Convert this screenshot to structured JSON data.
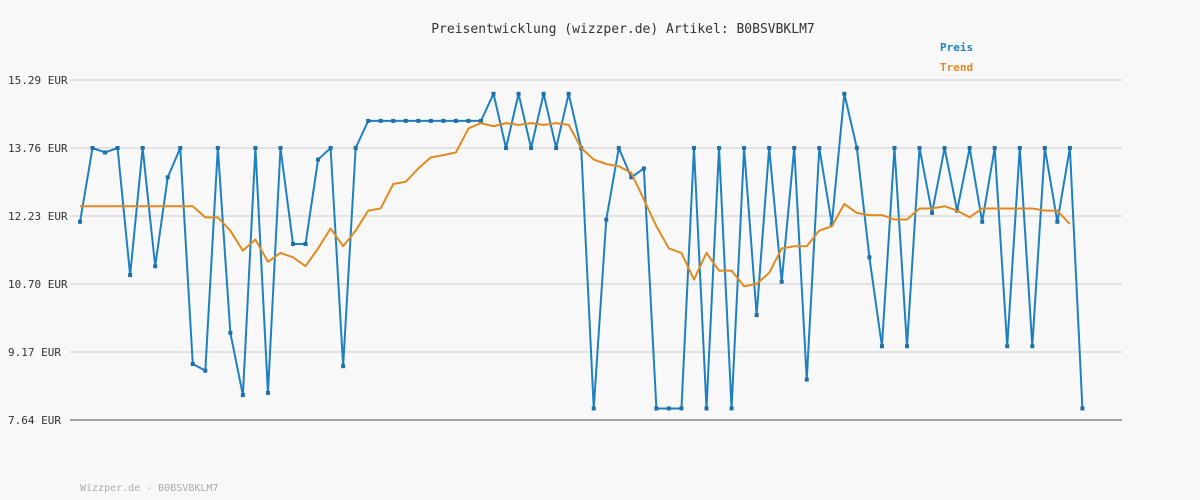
{
  "chart_data": {
    "type": "line",
    "title": "Preisentwicklung (wizzper.de) Artikel: B0BSVBKLM7",
    "xlabel": "",
    "ylabel": "",
    "ylim": [
      7.64,
      15.29
    ],
    "yticks": [
      "15.29 EUR",
      "13.76 EUR",
      "12.23 EUR",
      "10.70 EUR",
      "9.17 EUR",
      "7.64 EUR"
    ],
    "ytick_values": [
      15.29,
      13.76,
      12.23,
      10.7,
      9.17,
      7.64
    ],
    "grid": true,
    "legend_position": "top-right",
    "x": [
      1,
      2,
      3,
      4,
      5,
      6,
      7,
      8,
      9,
      10,
      11,
      12,
      13,
      14,
      15,
      16,
      17,
      18,
      19,
      20,
      21,
      22,
      23,
      24,
      25,
      26,
      27,
      28,
      29,
      30,
      31,
      32,
      33,
      34,
      35,
      36,
      37,
      38,
      39,
      40,
      41,
      42,
      43,
      44,
      45,
      46,
      47,
      48,
      49,
      50,
      51,
      52,
      53,
      54,
      55,
      56,
      57,
      58,
      59,
      60,
      61,
      62,
      63,
      64,
      65,
      66,
      67,
      68,
      69,
      70,
      71,
      72,
      73,
      74,
      75,
      76,
      77,
      78,
      79,
      80,
      81,
      82,
      83,
      84
    ],
    "series": [
      {
        "name": "Preis",
        "color": "#1f80c0",
        "values": [
          12.1,
          13.76,
          13.66,
          13.76,
          10.9,
          13.76,
          11.1,
          13.1,
          13.76,
          8.9,
          8.75,
          13.76,
          9.6,
          8.2,
          13.76,
          8.25,
          13.76,
          11.6,
          11.6,
          13.5,
          13.76,
          8.85,
          13.76,
          14.37,
          14.37,
          14.37,
          14.37,
          14.37,
          14.37,
          14.37,
          14.37,
          14.37,
          14.37,
          14.98,
          13.76,
          14.98,
          13.76,
          14.98,
          13.76,
          14.98,
          13.76,
          7.9,
          12.15,
          13.76,
          13.1,
          13.3,
          7.9,
          7.9,
          7.9,
          13.76,
          7.9,
          13.76,
          7.9,
          13.76,
          10.0,
          13.76,
          10.75,
          13.76,
          8.55,
          13.76,
          12.05,
          14.98,
          13.76,
          11.3,
          9.3,
          13.76,
          9.3,
          13.76,
          12.3,
          13.76,
          12.35,
          13.76,
          12.1,
          13.76,
          9.3,
          13.76,
          9.3,
          13.76,
          12.1,
          13.76,
          7.9
        ]
      },
      {
        "name": "Trend",
        "color": "#e08a20",
        "values": [
          12.45,
          12.45,
          12.45,
          12.45,
          12.45,
          12.45,
          12.45,
          12.45,
          12.45,
          12.45,
          12.2,
          12.2,
          11.9,
          11.45,
          11.7,
          11.2,
          11.4,
          11.3,
          11.1,
          11.5,
          11.95,
          11.55,
          11.9,
          12.35,
          12.4,
          12.95,
          13.0,
          13.3,
          13.55,
          13.6,
          13.66,
          14.2,
          14.32,
          14.25,
          14.32,
          14.28,
          14.32,
          14.28,
          14.32,
          14.28,
          13.76,
          13.5,
          13.4,
          13.35,
          13.2,
          12.6,
          12.0,
          11.5,
          11.4,
          10.8,
          11.4,
          11.0,
          11.0,
          10.65,
          10.7,
          10.95,
          11.5,
          11.55,
          11.55,
          11.9,
          12.0,
          12.5,
          12.3,
          12.25,
          12.25,
          12.15,
          12.15,
          12.4,
          12.4,
          12.45,
          12.35,
          12.2,
          12.4,
          12.4,
          12.4,
          12.4,
          12.4,
          12.35,
          12.35,
          12.05
        ]
      }
    ]
  },
  "footer": "Wizzper.de - B0BSVBKLM7"
}
